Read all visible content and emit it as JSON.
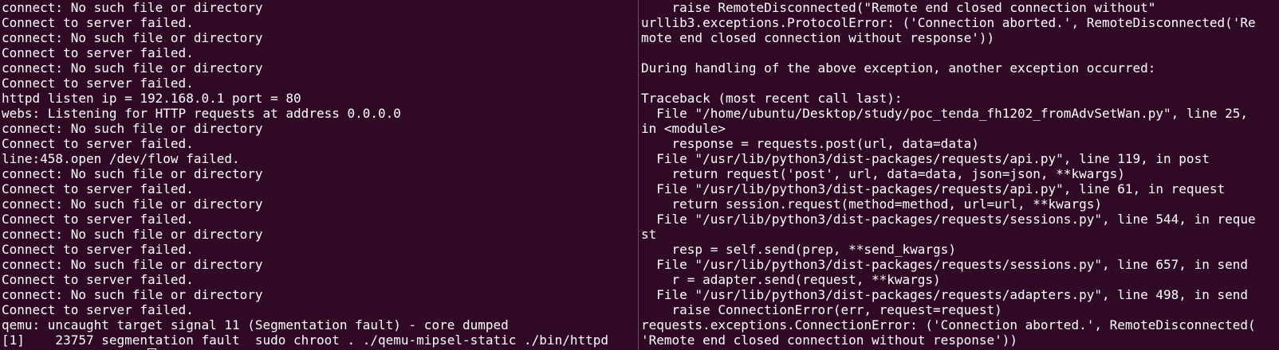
{
  "left_terminal": {
    "lines": [
      "connect: No such file or directory",
      "Connect to server failed.",
      "connect: No such file or directory",
      "Connect to server failed.",
      "connect: No such file or directory",
      "Connect to server failed.",
      "httpd listen ip = 192.168.0.1 port = 80",
      "webs: Listening for HTTP requests at address 0.0.0.0",
      "connect: No such file or directory",
      "Connect to server failed.",
      "line:458.open /dev/flow failed.",
      "connect: No such file or directory",
      "Connect to server failed.",
      "connect: No such file or directory",
      "Connect to server failed.",
      "connect: No such file or directory",
      "Connect to server failed.",
      "connect: No such file or directory",
      "Connect to server failed.",
      "connect: No such file or directory",
      "Connect to server failed.",
      "qemu: uncaught target signal 11 (Segmentation fault) - core dumped",
      "[1]    23757 segmentation fault  sudo chroot . ./qemu-mipsel-static ./bin/httpd"
    ]
  },
  "right_terminal": {
    "lines": [
      "    raise RemoteDisconnected(\"Remote end closed connection without\"",
      "urllib3.exceptions.ProtocolError: ('Connection aborted.', RemoteDisconnected('Re",
      "mote end closed connection without response'))",
      "",
      "During handling of the above exception, another exception occurred:",
      "",
      "Traceback (most recent call last):",
      "  File \"/home/ubuntu/Desktop/study/poc_tenda_fh1202_fromAdvSetWan.py\", line 25,",
      "in <module>",
      "    response = requests.post(url, data=data)",
      "  File \"/usr/lib/python3/dist-packages/requests/api.py\", line 119, in post",
      "    return request('post', url, data=data, json=json, **kwargs)",
      "  File \"/usr/lib/python3/dist-packages/requests/api.py\", line 61, in request",
      "    return session.request(method=method, url=url, **kwargs)",
      "  File \"/usr/lib/python3/dist-packages/requests/sessions.py\", line 544, in reque",
      "st",
      "    resp = self.send(prep, **send_kwargs)",
      "  File \"/usr/lib/python3/dist-packages/requests/sessions.py\", line 657, in send",
      "    r = adapter.send(request, **kwargs)",
      "  File \"/usr/lib/python3/dist-packages/requests/adapters.py\", line 498, in send",
      "    raise ConnectionError(err, request=request)",
      "requests.exceptions.ConnectionError: ('Connection aborted.', RemoteDisconnected(",
      "'Remote end closed connection without response'))"
    ]
  },
  "colors": {
    "background": "#300a24",
    "foreground": "#ffffff",
    "divider": "#6d4c62"
  }
}
